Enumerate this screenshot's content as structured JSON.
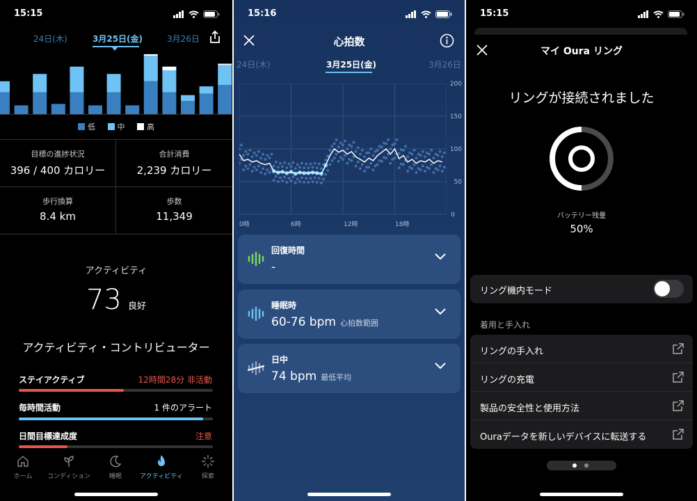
{
  "screens": [
    {
      "status_time": "15:15",
      "dates": [
        "24日(木)",
        "3月25日(金)",
        "3月26日"
      ],
      "legend": [
        {
          "label": "低",
          "color": "#3a7fc0"
        },
        {
          "label": "中",
          "color": "#6ec3f4"
        },
        {
          "label": "高",
          "color": "#ffffff"
        }
      ],
      "stats": [
        {
          "label": "目標の進捗状況",
          "value": "396 / 400 カロリー"
        },
        {
          "label": "合計消費",
          "value": "2,239 カロリー"
        },
        {
          "label": "歩行換算",
          "value": "8.4 km"
        },
        {
          "label": "歩数",
          "value": "11,349"
        }
      ],
      "activity_label": "アクティビティ",
      "activity_score": "73",
      "activity_rating": "良好",
      "contributors_title": "アクティビティ・コントリビューター",
      "contributors": [
        {
          "name": "ステイアクティブ",
          "value": "12時間28分 非活動",
          "fill": 0.54,
          "color": "#e8564a",
          "value_color": "#e8564a"
        },
        {
          "name": "毎時間活動",
          "value": "1 件のアラート",
          "fill": 0.95,
          "color": "#6ec3f4",
          "value_color": "#ffffff"
        },
        {
          "name": "日間目標達成度",
          "value": "注意",
          "fill": 0.25,
          "color": "#e8564a",
          "value_color": "#e8564a"
        }
      ],
      "nav": [
        {
          "label": "ホーム",
          "icon": "home-icon"
        },
        {
          "label": "コンディション",
          "icon": "sprout-icon"
        },
        {
          "label": "睡眠",
          "icon": "moon-icon"
        },
        {
          "label": "アクティビティ",
          "icon": "flame-icon"
        },
        {
          "label": "探索",
          "icon": "sparkle-icon"
        }
      ]
    },
    {
      "status_time": "15:16",
      "title": "心拍数",
      "dates": [
        "24日(木)",
        "3月25日(金)",
        "3月26日"
      ],
      "y_ticks": [
        "200",
        "150",
        "100",
        "50",
        "0"
      ],
      "x_ticks": [
        "0時",
        "6時",
        "12時",
        "18時"
      ],
      "cards": [
        {
          "title": "回復時間",
          "value": "-",
          "sub": "",
          "icon": "recovery-icon",
          "color": "#7ed957"
        },
        {
          "title": "睡眠時",
          "value": "60-76 bpm",
          "sub": "心拍数範囲",
          "icon": "sleep-hr-icon",
          "color": "#6ec3f4"
        },
        {
          "title": "日中",
          "value": "74 bpm",
          "sub": "最低平均",
          "icon": "daytime-hr-icon",
          "color": "#ffffff"
        }
      ]
    },
    {
      "status_time": "15:15",
      "title": "マイ Oura リング",
      "connected": "リングが接続されました",
      "battery_label": "バッテリー残量",
      "battery_value": "50%",
      "flight_mode": "リング機内モード",
      "section": "着用と手入れ",
      "links": [
        "リングの手入れ",
        "リングの充電",
        "製品の安全性と使用方法",
        "Ouraデータを新しいデバイスに転送する"
      ]
    }
  ],
  "chart_data": [
    {
      "type": "bar",
      "title": "",
      "series": [
        {
          "name": "低",
          "values": [
            30,
            12,
            30,
            14,
            30,
            12,
            30,
            12,
            45,
            30,
            18,
            28,
            40
          ]
        },
        {
          "name": "中",
          "values": [
            15,
            0,
            25,
            0,
            35,
            0,
            25,
            0,
            35,
            30,
            8,
            10,
            27
          ]
        },
        {
          "name": "高",
          "values": [
            0,
            0,
            0,
            0,
            0,
            0,
            0,
            0,
            2,
            5,
            0,
            0,
            2
          ]
        }
      ]
    },
    {
      "type": "line",
      "title": "",
      "xlabel": "",
      "ylabel": "",
      "xlim": [
        0,
        24
      ],
      "ylim": [
        0,
        200
      ],
      "series": [
        {
          "name": "",
          "x": [
            0,
            0.5,
            1,
            1.5,
            2,
            2.5,
            3,
            3.5,
            4,
            4.5,
            5,
            5.5,
            6,
            6.5,
            7,
            7.5,
            8,
            8.5,
            9,
            9.5,
            10,
            10.5,
            11,
            11.5,
            12,
            12.5,
            13,
            13.5,
            14,
            14.5,
            15,
            15.5,
            16,
            16.5,
            17,
            17.5,
            18,
            18.5,
            19,
            19.5,
            20,
            20.5,
            21,
            21.5,
            22,
            22.5,
            23,
            23.5
          ],
          "y": [
            92,
            82,
            84,
            80,
            82,
            78,
            76,
            78,
            66,
            64,
            65,
            63,
            65,
            62,
            64,
            63,
            63,
            64,
            63,
            62,
            75,
            90,
            100,
            95,
            98,
            92,
            96,
            88,
            84,
            80,
            86,
            82,
            90,
            95,
            100,
            92,
            100,
            85,
            90,
            80,
            84,
            78,
            82,
            80,
            84,
            78,
            82,
            80
          ]
        }
      ]
    }
  ]
}
